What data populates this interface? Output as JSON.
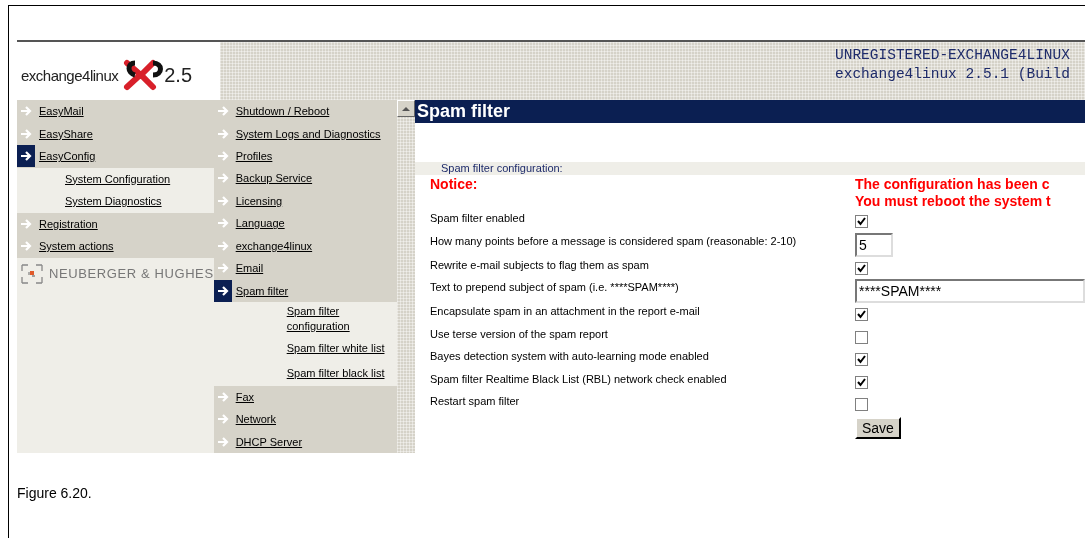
{
  "logo": {
    "name": "exchange4linux",
    "version": "2.5"
  },
  "header_info": [
    "UNREGISTERED-EXCHANGE4LINUX",
    "exchange4linux 2.5.1 (Build"
  ],
  "main_menu": [
    {
      "label": "EasyMail",
      "selected": false
    },
    {
      "label": "EasyShare",
      "selected": false
    },
    {
      "label": "EasyConfig",
      "selected": true,
      "children": [
        {
          "label": "System Configuration"
        },
        {
          "label": "System Diagnostics"
        }
      ]
    },
    {
      "label": "Registration",
      "selected": false
    },
    {
      "label": "System actions",
      "selected": false
    }
  ],
  "vendor": "NEUBERGER & HUGHES",
  "config_menu": [
    {
      "label": "Shutdown / Reboot",
      "selected": false
    },
    {
      "label": "System Logs and Diagnostics",
      "selected": false
    },
    {
      "label": "Profiles",
      "selected": false
    },
    {
      "label": "Backup Service",
      "selected": false
    },
    {
      "label": "Licensing",
      "selected": false
    },
    {
      "label": "Language",
      "selected": false
    },
    {
      "label": "exchange4linux",
      "selected": false
    },
    {
      "label": "Email",
      "selected": false
    },
    {
      "label": "Spam filter",
      "selected": true,
      "children": [
        {
          "label": "Spam filter configuration"
        },
        {
          "label": "Spam filter white list"
        },
        {
          "label": "Spam filter black list"
        }
      ]
    },
    {
      "label": "Fax",
      "selected": false
    },
    {
      "label": "Network",
      "selected": false
    },
    {
      "label": "DHCP Server",
      "selected": false
    }
  ],
  "page_title": "Spam filter",
  "section": "Spam filter configuration:",
  "notice": {
    "label": "Notice:",
    "lines": [
      "The configuration has been c",
      "You must reboot the system t"
    ]
  },
  "settings": [
    {
      "kind": "checkbox",
      "label": "Spam filter enabled",
      "checked": true
    },
    {
      "kind": "number",
      "label": "How many points before a message is considered spam (reasonable: 2-10)",
      "value": "5"
    },
    {
      "kind": "checkbox",
      "label": "Rewrite e-mail subjects to flag them as spam",
      "checked": true
    },
    {
      "kind": "text",
      "label": "Text to prepend subject of spam (i.e. ****SPAM****)",
      "value": "****SPAM****"
    },
    {
      "kind": "checkbox",
      "label": "Encapsulate spam in an attachment in the report e-mail",
      "checked": true
    },
    {
      "kind": "checkbox",
      "label": "Use terse version of the spam report",
      "checked": false
    },
    {
      "kind": "checkbox",
      "label": "Bayes detection system with auto-learning mode enabled",
      "checked": true
    },
    {
      "kind": "checkbox",
      "label": "Spam filter Realtime Black List (RBL) network check enabled",
      "checked": true
    },
    {
      "kind": "checkbox",
      "label": "Restart spam filter",
      "checked": false
    }
  ],
  "save_button": "Save",
  "caption": "Figure 6.20."
}
